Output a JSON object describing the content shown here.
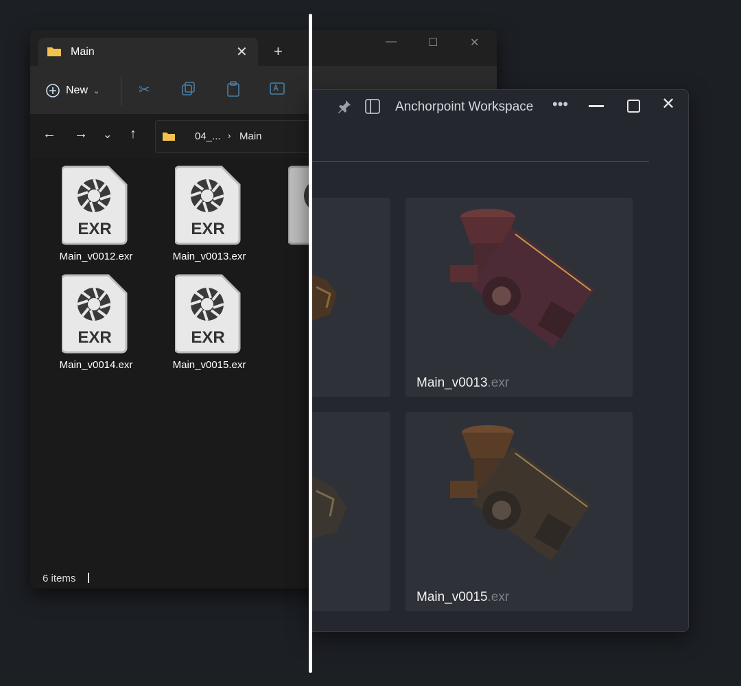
{
  "explorer": {
    "tab_title": "Main",
    "new_button": "New",
    "breadcrumb": {
      "part1": "04_...",
      "part2": "Main"
    },
    "files": [
      {
        "name": "Main_v0012.exr",
        "badge": "EXR"
      },
      {
        "name": "Main_v0013.exr",
        "badge": "EXR"
      },
      {
        "name": "Main_v0014.exr",
        "badge": "EXR"
      },
      {
        "name": "Main_v0015.exr",
        "badge": "EXR"
      },
      {
        "name": "Main_",
        "badge": "E"
      }
    ],
    "status": "6 items"
  },
  "anchorpoint": {
    "title": "Anchorpoint Workspace",
    "cards": [
      {
        "name": "Main_v0013",
        "ext": ".exr"
      },
      {
        "name": "Main_v0015",
        "ext": ".exr"
      }
    ]
  },
  "colors": {
    "folder": "#f2c14e",
    "accent_blue": "#4a7fa8",
    "background": "#1c1f24"
  }
}
